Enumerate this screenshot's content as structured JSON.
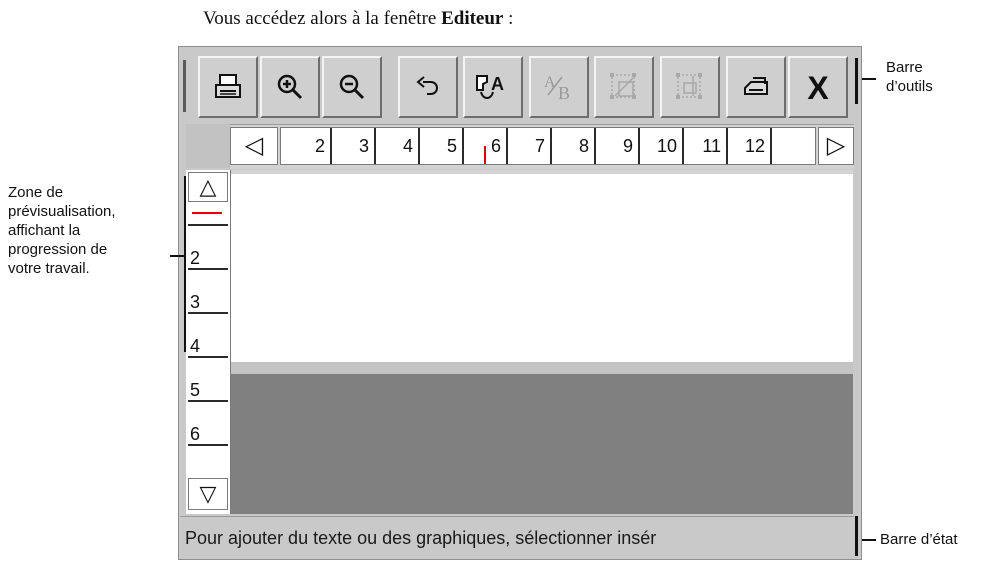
{
  "intro": {
    "prefix": "Vous accédez alors à la fenêtre ",
    "window_name": "Editeur",
    "suffix": " :"
  },
  "toolbar": {
    "buttons": [
      {
        "name": "print",
        "icon": "printer-icon",
        "enabled": true
      },
      {
        "name": "zoom-in",
        "icon": "zoom-in-icon",
        "enabled": true
      },
      {
        "name": "zoom-out",
        "icon": "zoom-out-icon",
        "enabled": true
      },
      {
        "name": "undo",
        "icon": "undo-icon",
        "enabled": true
      },
      {
        "name": "text-style",
        "icon": "text-style-icon",
        "label": "A",
        "enabled": true
      },
      {
        "name": "text-size",
        "icon": "text-size-icon",
        "label_a": "A",
        "label_b": "B",
        "enabled": false
      },
      {
        "name": "graphic-resize",
        "icon": "graphic-resize-icon",
        "enabled": false
      },
      {
        "name": "graphic-move",
        "icon": "graphic-move-icon",
        "enabled": false
      },
      {
        "name": "transfer",
        "icon": "transfer-icon",
        "enabled": true
      },
      {
        "name": "close",
        "icon": "close-icon",
        "label": "X",
        "enabled": true
      }
    ]
  },
  "ruler": {
    "left_arrow": "◁",
    "right_arrow": "▷",
    "ticks": [
      "2",
      "3",
      "4",
      "5",
      "6",
      "7",
      "8",
      "9",
      "10",
      "11",
      "12"
    ]
  },
  "vruler": {
    "up_arrow": "△",
    "down_arrow": "▽",
    "ticks": [
      "2",
      "3",
      "4",
      "5",
      "6"
    ]
  },
  "status": {
    "text": "Pour ajouter du texte ou des graphiques, sélectionner insér"
  },
  "callouts": {
    "toolbar": "Barre d’outils",
    "toolbar_line1": "Barre",
    "toolbar_line2": "d’outils",
    "preview_line1": "Zone de",
    "preview_line2": "prévisualisation,",
    "preview_line3": "affichant la",
    "preview_line4": "progression de",
    "preview_line5": "votre travail.",
    "statusbar": "Barre d’état"
  },
  "colors": {
    "cursor_marker": "#e00000",
    "preview_bg": "#ffffff",
    "pasteboard": "#808080"
  }
}
